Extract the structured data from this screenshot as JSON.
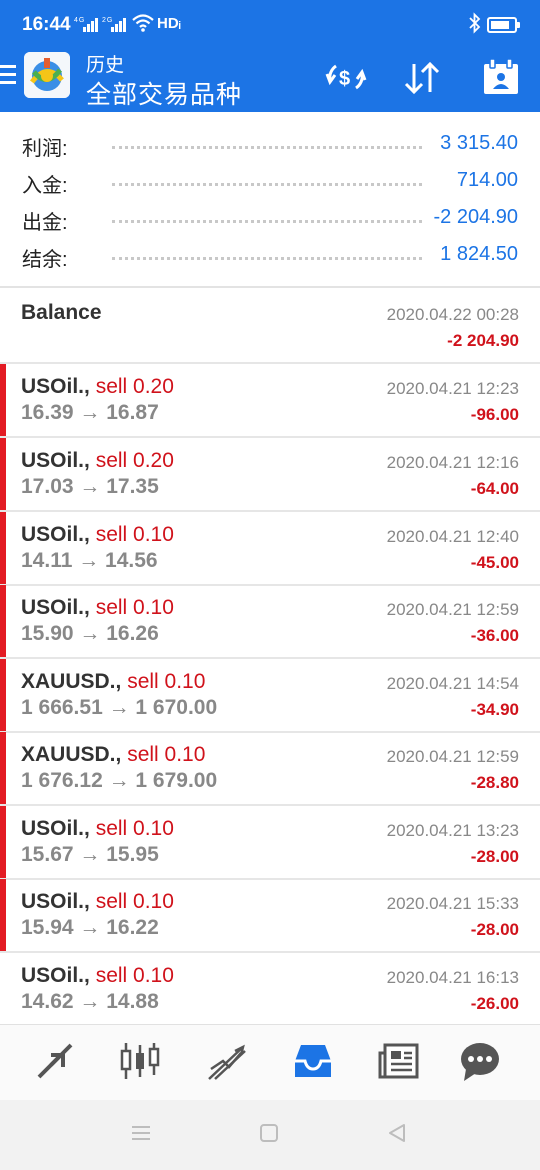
{
  "status_bar": {
    "time": "16:44",
    "signal": "4G 2G",
    "hd": "HDᵢ"
  },
  "header": {
    "title_small": "历史",
    "title_big": "全部交易品种",
    "icons": [
      "menu-icon",
      "currency-exchange-icon",
      "sort-icon",
      "calendar-icon"
    ]
  },
  "summary": {
    "rows": [
      {
        "label": "利润:",
        "value": "3 315.40"
      },
      {
        "label": "入金:",
        "value": "714.00"
      },
      {
        "label": "出金:",
        "value": "-2 204.90"
      },
      {
        "label": "结余:",
        "value": "1 824.50"
      }
    ]
  },
  "balance": {
    "label": "Balance",
    "time": "2020.04.22 00:28",
    "amount": "-2 204.90"
  },
  "deals": [
    {
      "symbol": "USOil.,",
      "side": "sell 0.20",
      "prices": "16.39 → 16.87",
      "time": "2020.04.21 12:23",
      "profit": "-96.00"
    },
    {
      "symbol": "USOil.,",
      "side": "sell 0.20",
      "prices": "17.03 → 17.35",
      "time": "2020.04.21 12:16",
      "profit": "-64.00"
    },
    {
      "symbol": "USOil.,",
      "side": "sell 0.10",
      "prices": "14.11 → 14.56",
      "time": "2020.04.21 12:40",
      "profit": "-45.00"
    },
    {
      "symbol": "USOil.,",
      "side": "sell 0.10",
      "prices": "15.90 → 16.26",
      "time": "2020.04.21 12:59",
      "profit": "-36.00"
    },
    {
      "symbol": "XAUUSD.,",
      "side": "sell 0.10",
      "prices": "1 666.51 → 1 670.00",
      "time": "2020.04.21 14:54",
      "profit": "-34.90"
    },
    {
      "symbol": "XAUUSD.,",
      "side": "sell 0.10",
      "prices": "1 676.12 → 1 679.00",
      "time": "2020.04.21 12:59",
      "profit": "-28.80"
    },
    {
      "symbol": "USOil.,",
      "side": "sell 0.10",
      "prices": "15.67 → 15.95",
      "time": "2020.04.21 13:23",
      "profit": "-28.00"
    },
    {
      "symbol": "USOil.,",
      "side": "sell 0.10",
      "prices": "15.94 → 16.22",
      "time": "2020.04.21 15:33",
      "profit": "-28.00"
    },
    {
      "symbol": "USOil.,",
      "side": "sell 0.10",
      "prices": "14.62 → 14.88",
      "time": "2020.04.21 16:13",
      "profit": "-26.00"
    }
  ],
  "bottom_nav": {
    "items": [
      "quotes-icon",
      "chart-icon",
      "trade-icon",
      "history-icon",
      "news-icon",
      "chat-icon"
    ],
    "active": "history-icon"
  },
  "colors": {
    "primary": "#1c74e5",
    "loss": "#d0121b",
    "sell_bar": "#e31b23",
    "muted": "#888888"
  }
}
